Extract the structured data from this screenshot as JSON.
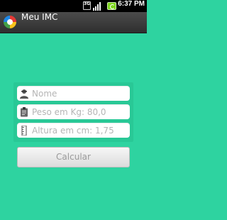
{
  "status_bar": {
    "network_label": "3G",
    "time": "6:37 PM",
    "icons": [
      "3g-icon",
      "signal-icon",
      "battery-icon",
      "clock-icon"
    ]
  },
  "title_bar": {
    "app_title": "Meu IMC",
    "app_icon": "app-logo-icon"
  },
  "form": {
    "name_field": {
      "placeholder": "Nome",
      "value": "",
      "icon": "person-icon"
    },
    "weight_field": {
      "placeholder": "Peso em Kg: 80,0",
      "value": "",
      "icon": "clipboard-icon"
    },
    "height_field": {
      "placeholder": "Altura em cm: 1,75",
      "value": "",
      "icon": "ruler-icon"
    }
  },
  "actions": {
    "calculate_label": "Calcular"
  },
  "colors": {
    "background": "#2ed3a0",
    "card": "#29c896",
    "titlebar": "#3a3a3a",
    "battery": "#7bd31b"
  }
}
